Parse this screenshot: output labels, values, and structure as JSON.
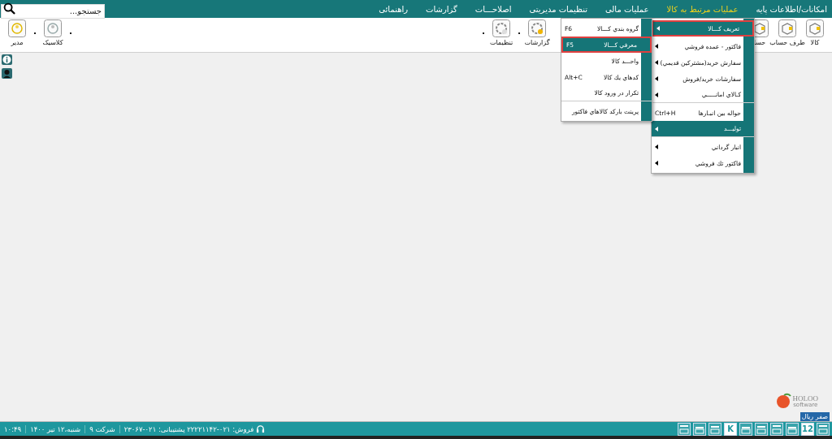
{
  "search": {
    "placeholder": "جستجو..."
  },
  "menubar": [
    {
      "label": "امکانات/اطلاعات پایه",
      "selected": false
    },
    {
      "label": "عملیات مرتبط به کالا",
      "selected": true
    },
    {
      "label": "عملیات مالی",
      "selected": false
    },
    {
      "label": "تنظیمات مدیریتی",
      "selected": false
    },
    {
      "label": "اصلاحـــات",
      "selected": false
    },
    {
      "label": "گزارشات",
      "selected": false
    },
    {
      "label": "راهنمائی",
      "selected": false
    }
  ],
  "toolbar": {
    "right": [
      {
        "kind": "button",
        "label": "کالا"
      },
      {
        "kind": "button",
        "label": "طرف حساب"
      },
      {
        "kind": "button",
        "label": "حسا"
      }
    ],
    "middle": [
      {
        "kind": "button",
        "label": "گزارشات"
      },
      {
        "kind": "dot"
      },
      {
        "kind": "button",
        "label": "تنظیمات"
      },
      {
        "kind": "dot"
      }
    ],
    "left": [
      {
        "kind": "dot"
      },
      {
        "kind": "button",
        "label": "کلاسیک"
      },
      {
        "kind": "dot"
      },
      {
        "kind": "button",
        "label": "مدیر"
      }
    ]
  },
  "menu": [
    {
      "label": "تعریف کـــالا",
      "submenu": true,
      "selected": true,
      "highlighted": true,
      "separator_after": true
    },
    {
      "label": "فاکتور - عمده فروشي",
      "submenu": true,
      "selected": false,
      "highlighted": false,
      "separator_after": false
    },
    {
      "label": "سفارش خريد(مشترکين قديمي)",
      "submenu": true,
      "selected": false,
      "highlighted": false,
      "separator_after": false
    },
    {
      "label": "سفارشات خريد/فروش",
      "submenu": true,
      "selected": false,
      "highlighted": false,
      "separator_after": false
    },
    {
      "label": "کـالاي امانـــــي",
      "submenu": true,
      "selected": false,
      "highlighted": false,
      "separator_after": true
    },
    {
      "label": "حواله بين انبـارها",
      "shortcut": "Ctrl+H",
      "submenu": false,
      "selected": false,
      "highlighted": false,
      "separator_after": false
    },
    {
      "label": "توليـــد",
      "submenu": true,
      "selected": false,
      "highlighted": true,
      "separator_after": true
    },
    {
      "label": "انبار گرداني",
      "submenu": true,
      "selected": false,
      "highlighted": false,
      "separator_after": false
    },
    {
      "label": "فاکتور تك فروشي",
      "submenu": true,
      "selected": false,
      "highlighted": false,
      "separator_after": false
    }
  ],
  "submenu": [
    {
      "label": "گروه بندي کـــالا",
      "shortcut": "F6",
      "selected": false,
      "separator_after": false
    },
    {
      "label": "معرفي کـــالا",
      "shortcut": "F5",
      "selected": true,
      "separator_after": false
    },
    {
      "label": "واحـــد کالا",
      "selected": false,
      "separator_after": false
    },
    {
      "label": "کدهاي يك کالا",
      "shortcut": "Alt+C",
      "selected": false,
      "separator_after": false
    },
    {
      "label": "تکرار در ورود کالا",
      "selected": false,
      "separator_after": true
    },
    {
      "label": "پرينت بارکد کالاهاي فاکتور",
      "selected": false,
      "separator_after": false
    }
  ],
  "logo": {
    "name": "HOLOO",
    "tagline": "software"
  },
  "balance": "صفر ریال",
  "status_bar": {
    "time": "۱۰:۴۹",
    "date": "شنبه،۱۲ تیر ۱۴۰۰",
    "company": "شرکت ۹",
    "contact": "فروش: ۰۲۱-۲۲۲۲۱۱۴۲ پشتیبانی: ۰۲۱-۲۳۰۶۷",
    "icons": [
      {
        "kind": "icon"
      },
      {
        "kind": "glyph",
        "glyph": "12"
      },
      {
        "kind": "icon"
      },
      {
        "kind": "icon"
      },
      {
        "kind": "icon"
      },
      {
        "kind": "icon"
      },
      {
        "kind": "glyph",
        "glyph": "K"
      },
      {
        "kind": "icon"
      },
      {
        "kind": "icon"
      },
      {
        "kind": "icon"
      }
    ]
  }
}
